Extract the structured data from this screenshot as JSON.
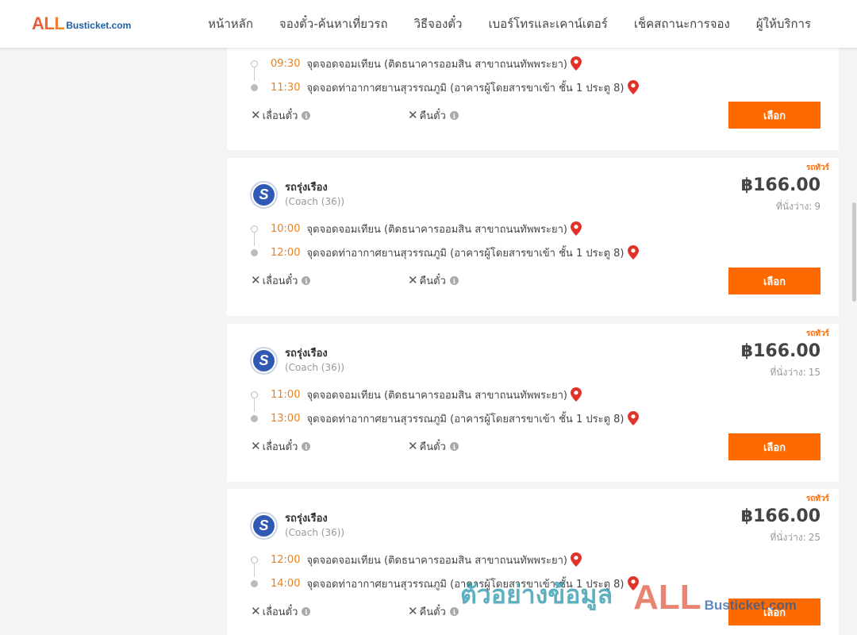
{
  "header": {
    "logo_all": "ALL",
    "logo_rest": "Busticket.com",
    "nav": [
      "หน้าหลัก",
      "จองตั๋ว-ค้นหาเที่ยวรถ",
      "วิธีจองตั๋ว",
      "เบอร์โทรและเคาน์เตอร์",
      "เช็คสถานะการจอง",
      "ผู้ให้บริการ"
    ]
  },
  "labels": {
    "change_ticket": "เลื่อนตั๋ว",
    "refund_ticket": "คืนตั๋ว",
    "select": "เลือก",
    "seats_prefix": "ที่นั่งว่าง:"
  },
  "trips": [
    {
      "depart_time": "09:30",
      "depart_place": "จุดจอดจอมเทียน (ติดธนาคารออมสิน สาขาถนนทัพพระยา)",
      "arrive_time": "11:30",
      "arrive_place": "จุดจอดท่าอากาศยานสุวรรณภูมิ (อาคารผู้โดยสารขาเข้า ชั้น 1 ประตู 8)"
    },
    {
      "tag": "รถทัวร์",
      "operator": "รถรุ่งเรือง",
      "bus_class": "(Coach (36))",
      "price": "฿166.00",
      "seats": "9",
      "depart_time": "10:00",
      "depart_place": "จุดจอดจอมเทียน (ติดธนาคารออมสิน สาขาถนนทัพพระยา)",
      "arrive_time": "12:00",
      "arrive_place": "จุดจอดท่าอากาศยานสุวรรณภูมิ (อาคารผู้โดยสารขาเข้า ชั้น 1 ประตู 8)"
    },
    {
      "tag": "รถทัวร์",
      "operator": "รถรุ่งเรือง",
      "bus_class": "(Coach (36))",
      "price": "฿166.00",
      "seats": "15",
      "depart_time": "11:00",
      "depart_place": "จุดจอดจอมเทียน (ติดธนาคารออมสิน สาขาถนนทัพพระยา)",
      "arrive_time": "13:00",
      "arrive_place": "จุดจอดท่าอากาศยานสุวรรณภูมิ (อาคารผู้โดยสารขาเข้า ชั้น 1 ประตู 8)"
    },
    {
      "tag": "รถทัวร์",
      "operator": "รถรุ่งเรือง",
      "bus_class": "(Coach (36))",
      "price": "฿166.00",
      "seats": "25",
      "depart_time": "12:00",
      "depart_place": "จุดจอดจอมเทียน (ติดธนาคารออมสิน สาขาถนนทัพพระยา)",
      "arrive_time": "14:00",
      "arrive_place": "จุดจอดท่าอากาศยานสุวรรณภูมิ (อาคารผู้โดยสารขาเข้า ชั้น 1 ประตู 8)"
    }
  ],
  "watermark": {
    "thai": "ตัวอย่างข้อมูล",
    "all": "ALL",
    "rest": "Busticket.com"
  },
  "colors": {
    "accent": "#ff6a00",
    "time": "#e9811e",
    "pin": "#e0342b"
  },
  "icons": {
    "pin": "map-pin-icon",
    "close": "x-icon",
    "info": "info-icon",
    "operator_logo": "operator-logo-icon"
  }
}
